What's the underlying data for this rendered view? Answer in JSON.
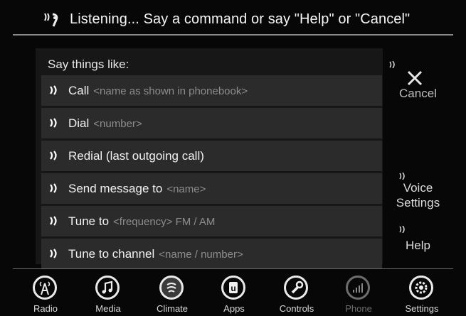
{
  "header": {
    "title": "Listening... Say a command or say \"Help\" or \"Cancel\""
  },
  "panel": {
    "heading": "Say things like:",
    "commands": [
      {
        "label": "Call",
        "hint": "<name as shown in phonebook>"
      },
      {
        "label": "Dial",
        "hint": "<number>"
      },
      {
        "label": "Redial (last outgoing call)",
        "hint": ""
      },
      {
        "label": "Send message to",
        "hint": "<name>"
      },
      {
        "label": "Tune to",
        "hint": "<frequency> FM / AM"
      },
      {
        "label": "Tune to channel",
        "hint": "<name / number>"
      }
    ]
  },
  "side": {
    "cancel": "Cancel",
    "voice_settings_1": "Voice",
    "voice_settings_2": "Settings",
    "help": "Help"
  },
  "nav": [
    {
      "label": "Radio",
      "icon": "radio-icon"
    },
    {
      "label": "Media",
      "icon": "music-note-icon"
    },
    {
      "label": "Climate",
      "icon": "climate-icon"
    },
    {
      "label": "Apps",
      "icon": "apps-icon"
    },
    {
      "label": "Controls",
      "icon": "wrench-icon"
    },
    {
      "label": "Phone",
      "icon": "phone-signal-icon"
    },
    {
      "label": "Settings",
      "icon": "gear-icon"
    }
  ],
  "colors": {
    "background": "#070707",
    "row": "#2b2b2b",
    "hint": "#8d8d8d",
    "disabled": "#6d6d6d"
  }
}
